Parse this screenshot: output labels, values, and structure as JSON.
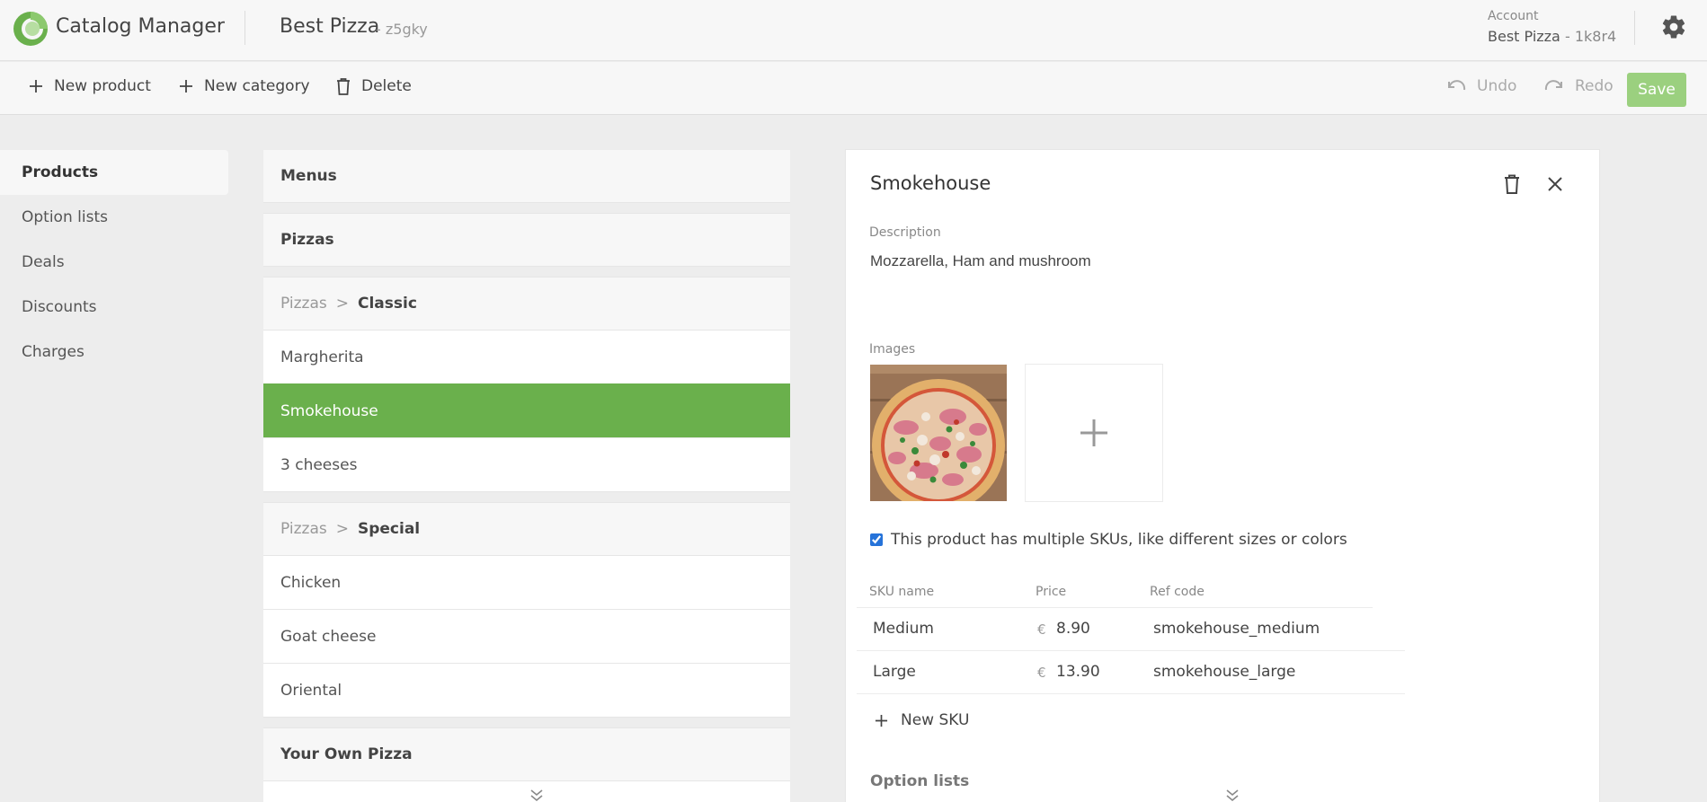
{
  "header": {
    "app_title": "Catalog Manager",
    "store_name": "Best Pizza",
    "store_id": "- z5gky",
    "account_label": "Account",
    "account_name": "Best Pizza",
    "account_id": "- 1k8r4",
    "icons": {
      "logo": "catalog-logo-icon",
      "settings": "gear-icon"
    }
  },
  "toolbar": {
    "new_product": "New product",
    "new_category": "New category",
    "delete": "Delete",
    "undo": "Undo",
    "redo": "Redo",
    "save": "Save",
    "accent_color": "#9bd07f"
  },
  "sidebar": {
    "items": [
      {
        "label": "Products",
        "active": true
      },
      {
        "label": "Option lists",
        "active": false
      },
      {
        "label": "Deals",
        "active": false
      },
      {
        "label": "Discounts",
        "active": false
      },
      {
        "label": "Charges",
        "active": false
      }
    ]
  },
  "product_list": {
    "groups": [
      {
        "title": "Menus",
        "products": []
      },
      {
        "title": "Pizzas",
        "products": []
      },
      {
        "parent": "Pizzas",
        "sep": ">",
        "title": "Classic",
        "products": [
          "Margherita",
          "Smokehouse",
          "3 cheeses"
        ]
      },
      {
        "parent": "Pizzas",
        "sep": ">",
        "title": "Special",
        "products": [
          "Chicken",
          "Goat cheese",
          "Oriental"
        ]
      },
      {
        "title": "Your Own Pizza",
        "products": []
      }
    ],
    "selected": "Smokehouse",
    "selected_color": "#6ab04c"
  },
  "detail": {
    "title": "Smokehouse",
    "description_label": "Description",
    "description": "Mozzarella, Ham and mushroom",
    "images_label": "Images",
    "multi_sku_checked": true,
    "multi_sku_text": "This product has multiple SKUs, like different sizes or colors",
    "sku_columns": {
      "name": "SKU name",
      "price": "Price",
      "ref": "Ref code"
    },
    "skus": [
      {
        "name": "Medium",
        "currency": "€",
        "price": "8.90",
        "ref": "smokehouse_medium"
      },
      {
        "name": "Large",
        "currency": "€",
        "price": "13.90",
        "ref": "smokehouse_large"
      }
    ],
    "new_sku": "New SKU",
    "option_lists_label": "Option lists"
  }
}
